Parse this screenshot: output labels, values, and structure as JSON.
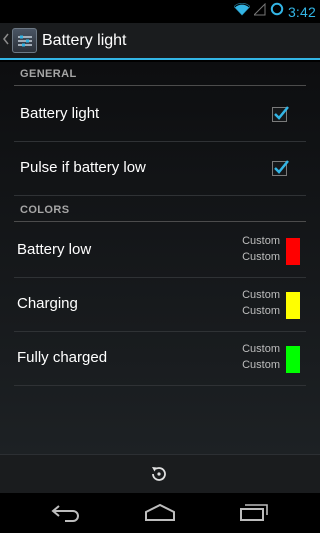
{
  "status_bar": {
    "time": "3:42",
    "icons": [
      "wifi-icon",
      "signal-icon",
      "battery-circle-icon"
    ]
  },
  "action_bar": {
    "title": "Battery light",
    "icon": "app-settings-icon",
    "up_icon": "chevron-left-icon"
  },
  "sections": {
    "general": {
      "header": "GENERAL",
      "items": [
        {
          "label": "Battery light",
          "checked": true
        },
        {
          "label": "Pulse if battery low",
          "checked": true
        }
      ]
    },
    "colors": {
      "header": "COLORS",
      "items": [
        {
          "label": "Battery low",
          "line1": "Custom",
          "line2": "Custom",
          "color": "#ff0000"
        },
        {
          "label": "Charging",
          "line1": "Custom",
          "line2": "Custom",
          "color": "#ffff00"
        },
        {
          "label": "Fully charged",
          "line1": "Custom",
          "line2": "Custom",
          "color": "#00ff00"
        }
      ]
    }
  },
  "bottom_bar": {
    "icon": "restore-defaults-icon"
  },
  "nav_bar": {
    "buttons": [
      "back-icon",
      "home-icon",
      "recent-apps-icon"
    ]
  },
  "colors": {
    "accent": "#33b5e5",
    "background_top": "#0d0e10",
    "background_bottom": "#1d2124"
  }
}
